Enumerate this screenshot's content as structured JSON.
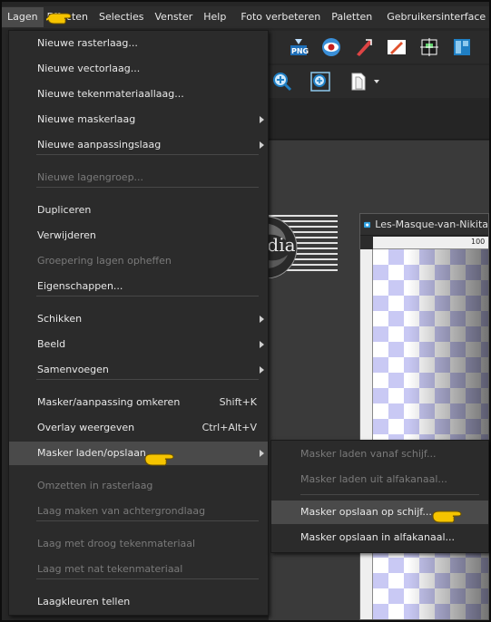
{
  "menubar": {
    "items": [
      "Lagen",
      "Effecten",
      "Selecties",
      "Venster",
      "Help",
      "Foto verbeteren",
      "Paletten",
      "Gebruikersinterface"
    ]
  },
  "menu": {
    "items": [
      {
        "label": "Nieuwe rasterlaag...",
        "state": "enabled"
      },
      {
        "label": "Nieuwe vectorlaag...",
        "state": "enabled"
      },
      {
        "label": "Nieuwe tekenmateriaallaag...",
        "state": "enabled"
      },
      {
        "label": "Nieuwe maskerlaag",
        "state": "enabled",
        "submenu": true
      },
      {
        "label": "Nieuwe aanpassingslaag",
        "state": "enabled",
        "submenu": true
      },
      {
        "label": "Nieuwe lagengroep...",
        "state": "disabled"
      },
      {
        "label": "Dupliceren",
        "state": "enabled"
      },
      {
        "label": "Verwijderen",
        "state": "enabled"
      },
      {
        "label": "Groepering lagen opheffen",
        "state": "disabled"
      },
      {
        "label": "Eigenschappen...",
        "state": "enabled"
      },
      {
        "label": "Schikken",
        "state": "enabled",
        "submenu": true
      },
      {
        "label": "Beeld",
        "state": "enabled",
        "submenu": true
      },
      {
        "label": "Samenvoegen",
        "state": "enabled",
        "submenu": true
      },
      {
        "label": "Masker/aanpassing omkeren",
        "state": "enabled",
        "shortcut": "Shift+K"
      },
      {
        "label": "Overlay weergeven",
        "state": "enabled",
        "shortcut": "Ctrl+Alt+V"
      },
      {
        "label": "Masker laden/opslaan",
        "state": "highlighted",
        "submenu": true
      },
      {
        "label": "Omzetten in rasterlaag",
        "state": "disabled"
      },
      {
        "label": "Laag maken van achtergrondlaag",
        "state": "disabled"
      },
      {
        "label": "Laag met droog tekenmateriaal",
        "state": "disabled"
      },
      {
        "label": "Laag met nat tekenmateriaal",
        "state": "disabled"
      },
      {
        "label": "Laagkleuren tellen",
        "state": "enabled"
      }
    ]
  },
  "submenu": {
    "items": [
      {
        "label": "Masker laden vanaf schijf...",
        "state": "disabled"
      },
      {
        "label": "Masker laden uit alfakanaal...",
        "state": "disabled"
      },
      {
        "label": "Masker opslaan op schijf...",
        "state": "highlighted"
      },
      {
        "label": "Masker opslaan in alfakanaal...",
        "state": "enabled"
      }
    ]
  },
  "image_window": {
    "title": "Les-Masque-van-Nikita",
    "ruler_top_label": "100"
  },
  "watermark": {
    "text": "claudia"
  },
  "colors": {
    "menu_bg": "#2b2b2b",
    "highlight": "#4a4a4a",
    "disabled_text": "#7a7a7a",
    "checker": "#c9c9f4",
    "hand": "#f5c400"
  }
}
